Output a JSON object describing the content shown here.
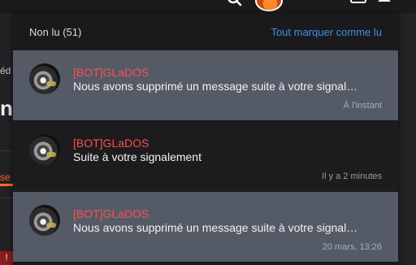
{
  "background": {
    "frag_1": "éd",
    "frag_2": "n",
    "frag_3": "se",
    "badge": "!"
  },
  "dropdown": {
    "title": "Non lu (51)",
    "mark_all_read": "Tout marquer comme lu",
    "notifications": [
      {
        "author": "[BOT]GLaDOS",
        "text": "Nous avons supprimé un message suite à votre signal…",
        "time": "À l'instant",
        "state": "unread"
      },
      {
        "author": "[BOT]GLaDOS",
        "text": "Suite à votre signalement",
        "time": "Il y a 2 minutes",
        "state": "read"
      },
      {
        "author": "[BOT]GLaDOS",
        "text": "Nous avons supprimé un message suite à votre signal…",
        "time": "20 mars, 13:26",
        "state": "unread"
      }
    ]
  },
  "icons": [
    "search-icon",
    "user-avatar",
    "inbox-icon",
    "bell-icon",
    "menu-icon"
  ],
  "colors": {
    "accent": "#3f8fe0",
    "author": "#ff4f4f",
    "unread_bg": "#545b66",
    "read_bg": "#1c1c1e"
  }
}
